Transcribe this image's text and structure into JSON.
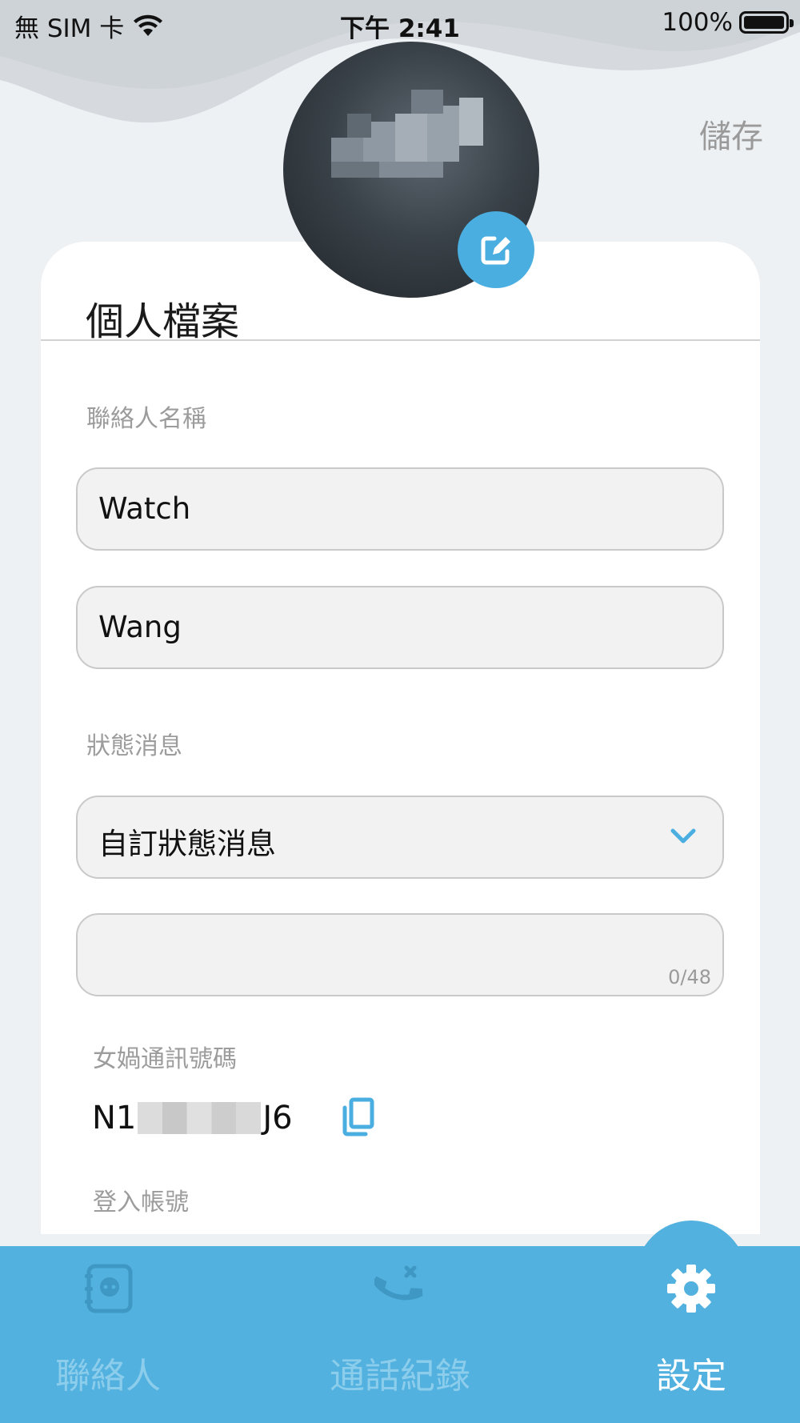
{
  "status_bar": {
    "carrier": "無 SIM 卡",
    "time": "下午 2:41",
    "battery": "100%"
  },
  "header": {
    "save_label": "儲存"
  },
  "profile": {
    "title": "個人檔案",
    "contact_name_label": "聯絡人名稱",
    "first_name": "Watch",
    "last_name": "Wang",
    "status_message_label": "狀態消息",
    "status_select_value": "自訂狀態消息",
    "status_text_value": "",
    "status_counter": "0/48",
    "nuwa_id_label": "女媧通訊號碼",
    "nuwa_id_prefix": "N1",
    "nuwa_id_suffix": "J6",
    "login_account_label": "登入帳號"
  },
  "tabs": [
    {
      "label": "聯絡人",
      "icon": "contacts-book-icon",
      "active": false
    },
    {
      "label": "通話紀錄",
      "icon": "call-log-icon",
      "active": false
    },
    {
      "label": "設定",
      "icon": "gear-icon",
      "active": true
    }
  ],
  "colors": {
    "accent": "#52b1df",
    "edit_button": "#4aaee0",
    "label_gray": "#9c9c9c",
    "inactive_tab": "#8ccdec"
  }
}
